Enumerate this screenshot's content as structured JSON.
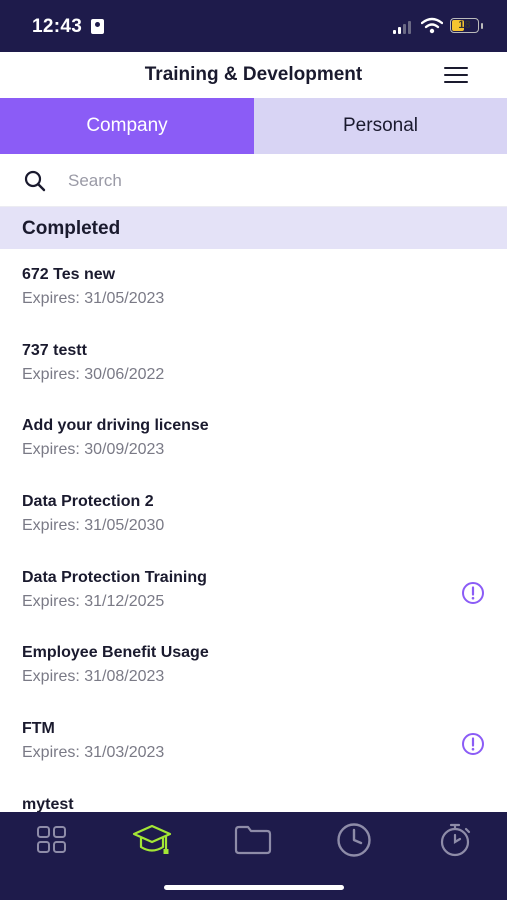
{
  "status_bar": {
    "time": "12:43",
    "battery": "18"
  },
  "header": {
    "title": "Training & Development",
    "menu_icon": "hamburger-menu-icon"
  },
  "tabs": [
    {
      "label": "Company",
      "active": true
    },
    {
      "label": "Personal",
      "active": false
    }
  ],
  "search": {
    "placeholder": "Search",
    "value": ""
  },
  "section": {
    "title": "Completed"
  },
  "items": [
    {
      "name": "672 Tes new",
      "expiry": "Expires: 31/05/2023",
      "alert": false
    },
    {
      "name": "737 testt",
      "expiry": "Expires: 30/06/2022",
      "alert": false
    },
    {
      "name": "Add your driving license",
      "expiry": "Expires: 30/09/2023",
      "alert": false
    },
    {
      "name": "Data Protection 2",
      "expiry": "Expires: 31/05/2030",
      "alert": false
    },
    {
      "name": "Data Protection Training",
      "expiry": "Expires: 31/12/2025",
      "alert": true
    },
    {
      "name": "Employee Benefit Usage",
      "expiry": "Expires: 31/08/2023",
      "alert": false
    },
    {
      "name": "FTM",
      "expiry": "Expires: 31/03/2023",
      "alert": true
    },
    {
      "name": "mytest",
      "expiry": "",
      "alert": false
    }
  ],
  "bottom_nav": [
    {
      "icon": "grid-icon",
      "active": false
    },
    {
      "icon": "graduation-cap-icon",
      "active": true
    },
    {
      "icon": "folder-icon",
      "active": false
    },
    {
      "icon": "clock-icon",
      "active": false
    },
    {
      "icon": "stopwatch-icon",
      "active": false
    }
  ],
  "colors": {
    "accent": "#8b5cf6",
    "tab_inactive": "#d8d4f4",
    "navy": "#1e1b4b",
    "section_bg": "#e4e2f7",
    "nav_active": "#a3e635",
    "nav_inactive": "#8e8ca8"
  }
}
